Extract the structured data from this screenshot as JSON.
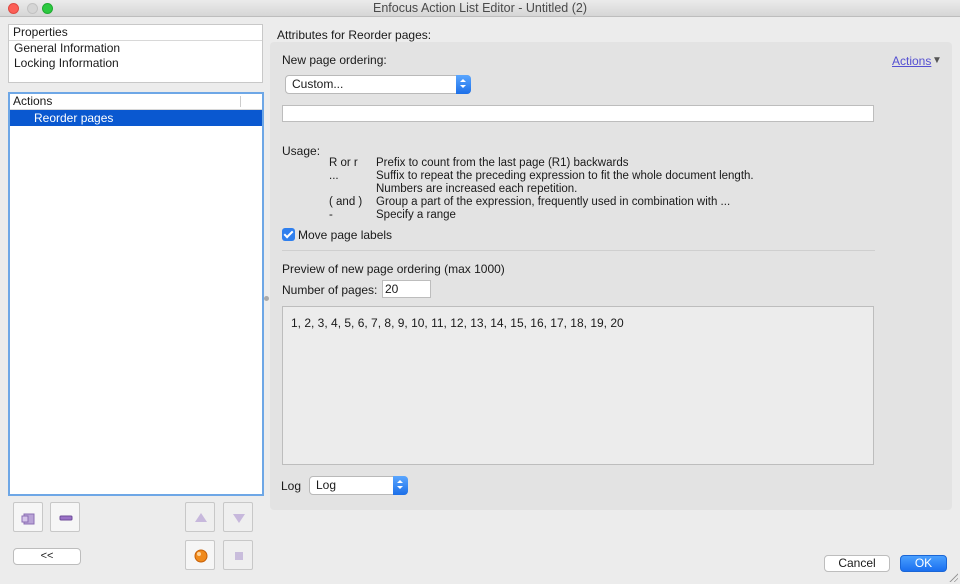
{
  "window": {
    "title": "Enfocus Action List Editor - Untitled (2)"
  },
  "properties": {
    "header": "Properties",
    "items": [
      "General Information",
      "Locking Information"
    ]
  },
  "actions_list": {
    "header": "Actions",
    "items": [
      {
        "label": "Reorder pages",
        "selected": true
      }
    ]
  },
  "left_toolbar": {
    "collapse_label": "<<",
    "icons": [
      "add-action-icon",
      "remove-action-icon",
      "move-up-icon",
      "move-down-icon",
      "run-icon",
      "stop-icon"
    ]
  },
  "attributes": {
    "section_label": "Attributes for Reorder pages:",
    "actions_menu_label": "Actions",
    "ordering_label": "New page ordering:",
    "ordering_select_value": "Custom...",
    "expression_value": "",
    "usage_label": "Usage:",
    "usage": [
      {
        "key": "R or r",
        "desc": "Prefix to count from the last page (R1) backwards"
      },
      {
        "key": "...",
        "desc": "Suffix to repeat the preceding expression to fit the whole document length."
      },
      {
        "key": "",
        "desc": "Numbers are increased each repetition."
      },
      {
        "key": "( and )",
        "desc": "Group a part of the expression, frequently used in combination with ..."
      },
      {
        "key": "-",
        "desc": "Specify a range"
      }
    ],
    "move_labels": {
      "label": "Move page labels",
      "checked": true
    },
    "preview_label": "Preview of new page ordering (max 1000)",
    "num_pages_label": "Number of pages:",
    "num_pages_value": "20",
    "preview_text": "1, 2, 3, 4, 5, 6, 7, 8, 9, 10, 11, 12, 13, 14, 15, 16, 17, 18, 19, 20",
    "log_label": "Log",
    "log_select_value": "Log"
  },
  "footer": {
    "cancel_label": "Cancel",
    "ok_label": "OK"
  },
  "colors": {
    "accent": "#1a6ff0",
    "selection": "#0a58d0",
    "link": "#5550d2"
  }
}
